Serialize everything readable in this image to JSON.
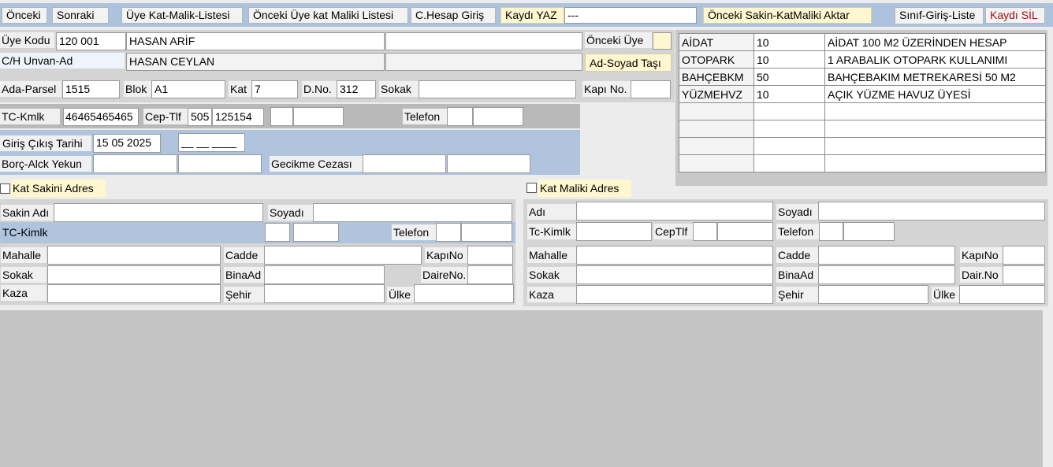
{
  "toolbar": {
    "prev": "Önceki",
    "next": "Sonraki",
    "member_list": "Üye Kat-Malik-Listesi",
    "prev_member_list": "Önceki Üye kat Maliki Listesi",
    "account_entry": "C.Hesap Giriş",
    "save": "Kaydı YAZ",
    "save_status": "---",
    "transfer_prev": "Önceki Sakin-KatMaliki Aktar",
    "class_entry_list": "Sınıf-Giriş-Liste",
    "delete": "Kaydı SİL"
  },
  "member": {
    "code_label": "Üye Kodu",
    "code_value": "120 001",
    "name_value": "HASAN ARİF",
    "name_extra": "",
    "prev_member_label": "Önceki Üye",
    "title_label": "C/H Unvan-Ad",
    "title_value": "HASAN CEYLAN",
    "title_extra": "",
    "move_name_button": "Ad-Soyad Taşı",
    "parcel_label": "Ada-Parsel",
    "parcel_value": "1515",
    "block_label": "Blok",
    "block_value": "A1",
    "floor_label": "Kat",
    "floor_value": "7",
    "door_label": "D.No.",
    "door_value": "312",
    "street_label": "Sokak",
    "street_value": "",
    "gate_label": "Kapı No.",
    "gate_value": "",
    "tc_label": "TC-Kmlk",
    "tc_value": "46465465465",
    "mobile_label": "Cep-Tlf",
    "mobile_prefix": "505",
    "mobile_number": "125154",
    "phone_label": "Telefon",
    "entry_exit_label": "Giriş Çıkış Tarihi",
    "entry_date": "15 05 2025",
    "exit_date": "__ __ ____",
    "debt_label": "Borç-Alck Yekun",
    "late_fee_label": "Gecikme Cezası"
  },
  "dues": [
    {
      "code": "AİDAT",
      "amount": "10",
      "desc": "AİDAT 100 M2 ÜZERİNDEN HESAP"
    },
    {
      "code": "OTOPARK",
      "amount": "10",
      "desc": "1 ARABALIK OTOPARK KULLANIMI"
    },
    {
      "code": "BAHÇEBKM",
      "amount": "50",
      "desc": "BAHÇEBAKIM METREKARESİ 50 M2"
    },
    {
      "code": "YÜZMEHVZ",
      "amount": "10",
      "desc": "AÇIK YÜZME HAVUZ ÜYESİ"
    },
    {
      "code": "",
      "amount": "",
      "desc": ""
    },
    {
      "code": "",
      "amount": "",
      "desc": ""
    },
    {
      "code": "",
      "amount": "",
      "desc": ""
    },
    {
      "code": "",
      "amount": "",
      "desc": ""
    }
  ],
  "resident": {
    "section_label": "Kat Sakini Adres",
    "name_label": "Sakin Adı",
    "surname_label": "Soyadı",
    "tc_label": "TC-Kimlk",
    "phone_label": "Telefon",
    "district_label": "Mahalle",
    "avenue_label": "Cadde",
    "gate_label": "KapıNo",
    "street_label": "Sokak",
    "building_label": "BinaAd",
    "apartment_label": "DaireNo.",
    "county_label": "Kaza",
    "city_label": "Şehir",
    "country_label": "Ülke"
  },
  "owner": {
    "section_label": "Kat Maliki Adres",
    "name_label": "Adı",
    "surname_label": "Soyadı",
    "tc_label": "Tc-Kimlk",
    "mobile_label": "CepTlf",
    "phone_label": "Telefon",
    "district_label": "Mahalle",
    "avenue_label": "Cadde",
    "gate_label": "KapıNo",
    "street_label": "Sokak",
    "building_label": "BinaAd",
    "apartment_label": "Dair.No",
    "county_label": "Kaza",
    "city_label": "Şehir",
    "country_label": "Ülke"
  },
  "colors": {
    "toolbar_bg": "#adc3dd",
    "panel_grey": "#d4d4d4",
    "panel_blue": "#b0c4de",
    "bottom_grey": "#c4c4c4"
  }
}
